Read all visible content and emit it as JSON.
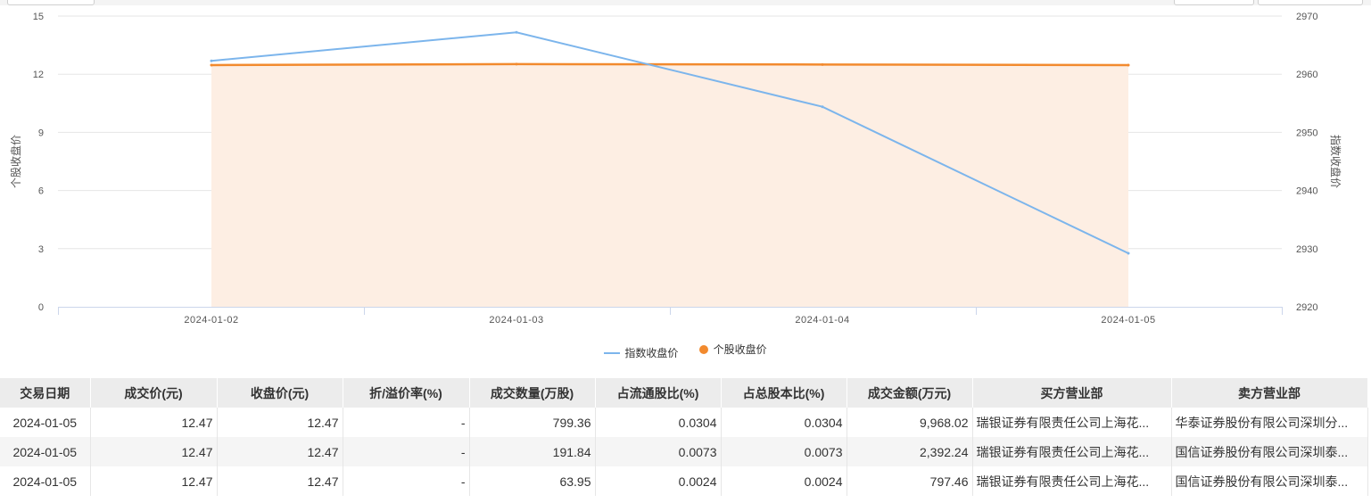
{
  "chart_data": {
    "type": "line",
    "categories": [
      "2024-01-02",
      "2024-01-03",
      "2024-01-04",
      "2024-01-05"
    ],
    "series": [
      {
        "name": "指数收盘价",
        "axis": "right",
        "color": "#7cb5ec",
        "values": [
          2962.3,
          2967.2,
          2954.4,
          2929.2
        ]
      },
      {
        "name": "个股收盘价",
        "axis": "left",
        "color": "#f28a2e",
        "area_fill": "#fdeee3",
        "values": [
          12.47,
          12.52,
          12.5,
          12.47
        ]
      }
    ],
    "ylabel": "个股收盘价",
    "ylabel_right": "指数收盘价",
    "ylim": [
      0,
      15
    ],
    "yticks": [
      "0",
      "3",
      "6",
      "9",
      "12",
      "15"
    ],
    "ylim_right": [
      2920,
      2970
    ],
    "yticks_right": [
      "2920",
      "2930",
      "2940",
      "2950",
      "2960",
      "2970"
    ],
    "grid": true,
    "legend": "bottom-center"
  },
  "table": {
    "headers": [
      "交易日期",
      "成交价(元)",
      "收盘价(元)",
      "折/溢价率(%)",
      "成交数量(万股)",
      "占流通股比(%)",
      "占总股本比(%)",
      "成交金额(万元)",
      "买方营业部",
      "卖方营业部"
    ],
    "rows": [
      [
        "2024-01-05",
        "12.47",
        "12.47",
        "-",
        "799.36",
        "0.0304",
        "0.0304",
        "9,968.02",
        "瑞银证券有限责任公司上海花...",
        "华泰证券股份有限公司深圳分..."
      ],
      [
        "2024-01-05",
        "12.47",
        "12.47",
        "-",
        "191.84",
        "0.0073",
        "0.0073",
        "2,392.24",
        "瑞银证券有限责任公司上海花...",
        "国信证券股份有限公司深圳泰..."
      ],
      [
        "2024-01-05",
        "12.47",
        "12.47",
        "-",
        "63.95",
        "0.0024",
        "0.0024",
        "797.46",
        "瑞银证券有限责任公司上海花...",
        "国信证券股份有限公司深圳泰..."
      ]
    ]
  }
}
